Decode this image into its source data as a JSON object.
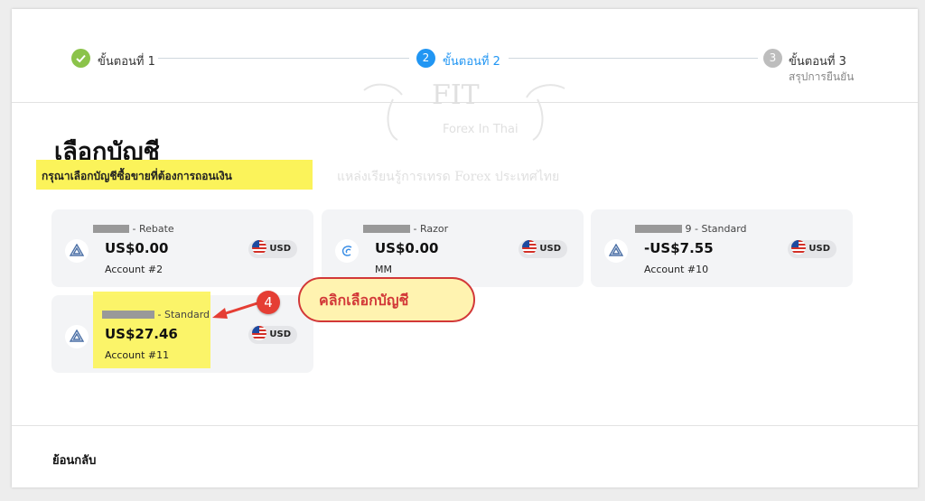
{
  "stepper": {
    "steps": [
      {
        "number": "",
        "label": "ขั้นตอนที่ 1",
        "sublabel": "",
        "state": "done"
      },
      {
        "number": "2",
        "label": "ขั้นตอนที่ 2",
        "sublabel": "",
        "state": "active"
      },
      {
        "number": "3",
        "label": "ขั้นตอนที่ 3",
        "sublabel": "สรุปการยืนยัน",
        "state": "pending"
      }
    ]
  },
  "heading": "เลือกบัญชี",
  "subtitle": "กรุณาเลือกบัญชีซื้อขายที่ต้องการถอนเงิน",
  "watermark": {
    "brand": "FIT",
    "brand_sub": "Forex In Thai",
    "tagline": "แหล่งเรียนรู้การเทรด Forex ประเทศไทย"
  },
  "accounts": [
    {
      "title_suffix": "- Rebate",
      "balance": "US$0.00",
      "account": "Account #2",
      "currency": "USD",
      "icon": "triangle-logo-icon"
    },
    {
      "title_suffix": "- Razor",
      "balance": "US$0.00",
      "account": "MM",
      "currency": "USD",
      "icon": "wave-logo-icon"
    },
    {
      "title_suffix": "9 - Standard",
      "balance": "-US$7.55",
      "account": "Account #10",
      "currency": "USD",
      "icon": "triangle-logo-icon"
    },
    {
      "title_suffix": "- Standard",
      "balance": "US$27.46",
      "account": "Account #11",
      "currency": "USD",
      "icon": "triangle-logo-icon"
    }
  ],
  "annotation": {
    "number": "4",
    "text": "คลิกเลือกบัญชี"
  },
  "colors": {
    "done": "#8bc34a",
    "active": "#2196f3",
    "pending": "#bdbdbd",
    "highlight": "#fbf35a",
    "callout_border": "#d23838"
  },
  "footer": {
    "back_label": "ย้อนกลับ"
  }
}
